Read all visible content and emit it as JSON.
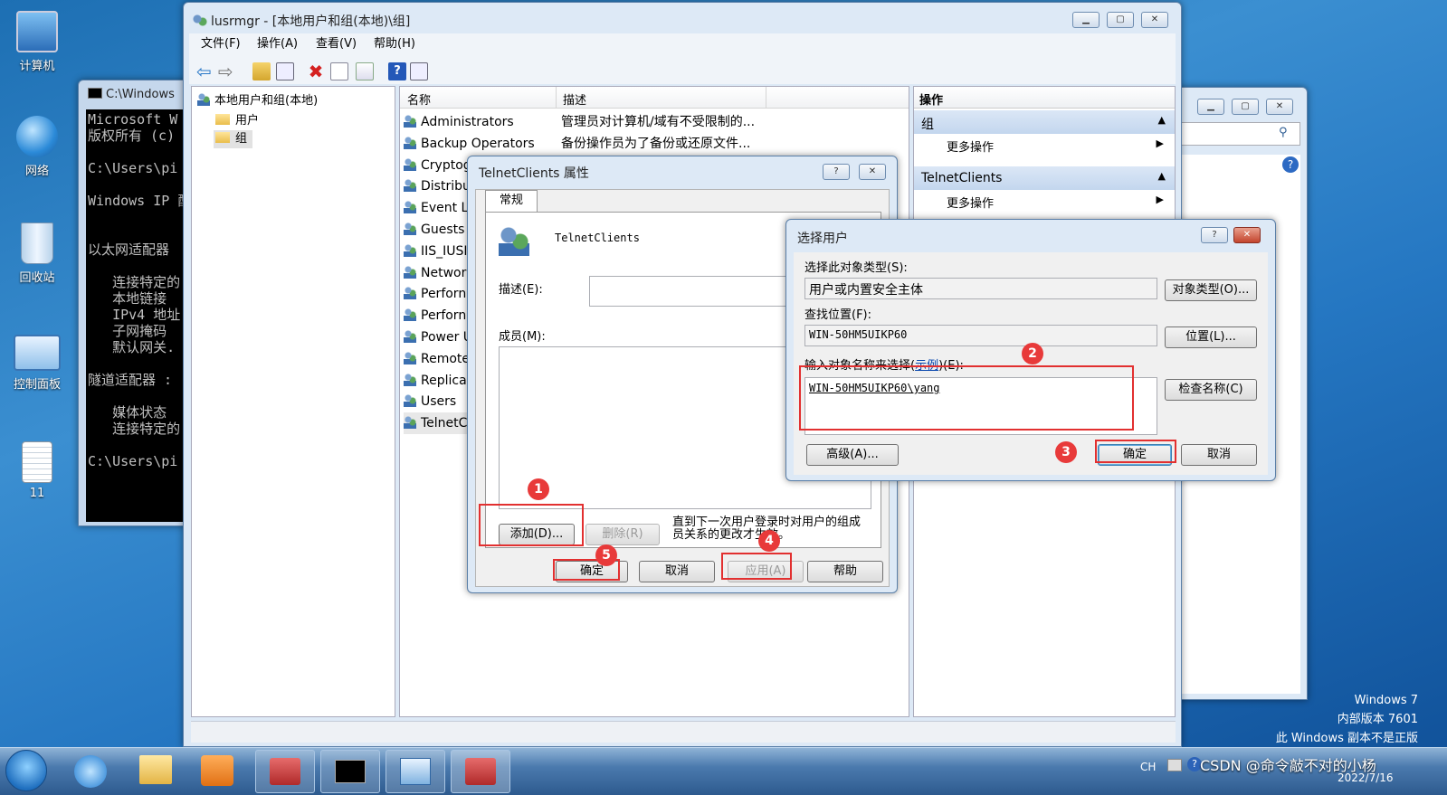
{
  "desktop": {
    "icons": [
      {
        "label": "计算机",
        "icon": "computer-icon"
      },
      {
        "label": "网络",
        "icon": "network-icon"
      },
      {
        "label": "回收站",
        "icon": "recycle-bin-icon"
      },
      {
        "label": "控制面板",
        "icon": "control-panel-icon"
      },
      {
        "label": "11",
        "icon": "text-file-icon"
      }
    ],
    "watermark": {
      "line1": "Windows 7",
      "line2": "内部版本 7601",
      "line3": "此 Windows 副本不是正版"
    },
    "credit": "CSDN @命令敲不对的小杨"
  },
  "cmd": {
    "title": "C:\\Windows",
    "lines": [
      "Microsoft W",
      "版权所有 (c)",
      "",
      "C:\\Users\\pi",
      "",
      "Windows IP 配",
      "",
      "",
      "以太网适配器",
      "",
      "   连接特定的",
      "   本地链接",
      "   IPv4 地址",
      "   子网掩码",
      "   默认网关.",
      "",
      "隧道适配器 :",
      "",
      "   媒体状态",
      "   连接特定的",
      "",
      "C:\\Users\\pi"
    ]
  },
  "mmc": {
    "title": "lusrmgr - [本地用户和组(本地)\\组]",
    "menu": [
      "文件(F)",
      "操作(A)",
      "查看(V)",
      "帮助(H)"
    ],
    "tree": {
      "root": "本地用户和组(本地)",
      "children": [
        "用户",
        "组"
      ]
    },
    "columns": [
      "名称",
      "描述"
    ],
    "groups": [
      {
        "name": "Administrators",
        "desc": "管理员对计算机/域有不受限制的..."
      },
      {
        "name": "Backup Operators",
        "desc": "备份操作员为了备份或还原文件..."
      },
      {
        "name": "Cryptog",
        "desc": ""
      },
      {
        "name": "Distribu",
        "desc": ""
      },
      {
        "name": "Event L",
        "desc": ""
      },
      {
        "name": "Guests",
        "desc": ""
      },
      {
        "name": "IIS_IUSI",
        "desc": ""
      },
      {
        "name": "Networ",
        "desc": ""
      },
      {
        "name": "Perforn",
        "desc": ""
      },
      {
        "name": "Perforn",
        "desc": ""
      },
      {
        "name": "Power U",
        "desc": ""
      },
      {
        "name": "Remote",
        "desc": ""
      },
      {
        "name": "Replica",
        "desc": ""
      },
      {
        "name": "Users",
        "desc": ""
      },
      {
        "name": "TelnetC",
        "desc": ""
      }
    ],
    "actions": {
      "header": "操作",
      "sections": [
        {
          "title": "组",
          "item": "更多操作"
        },
        {
          "title": "TelnetClients",
          "item": "更多操作"
        }
      ]
    }
  },
  "props": {
    "title": "TelnetClients 属性",
    "tab": "常规",
    "group_name": "TelnetClients",
    "desc_label": "描述(E):",
    "members_label": "成员(M):",
    "add_button": "添加(D)...",
    "remove_button": "删除(R)",
    "note": "直到下一次用户登录时对用户的组成员关系的更改才生效。",
    "ok": "确定",
    "cancel": "取消",
    "apply": "应用(A)",
    "help": "帮助"
  },
  "select_user": {
    "title": "选择用户",
    "type_label": "选择此对象类型(S):",
    "type_value": "用户或内置安全主体",
    "type_button": "对象类型(O)...",
    "location_label": "查找位置(F):",
    "location_value": "WIN-50HM5UIKP60",
    "location_button": "位置(L)...",
    "enter_label_pre": "输入对象名称来选择(",
    "enter_label_link": "示例",
    "enter_label_post": ")(E):",
    "entered_value": "WIN-50HM5UIKP60\\yang",
    "check_button": "检查名称(C)",
    "advanced_button": "高级(A)...",
    "ok": "确定",
    "cancel": "取消"
  },
  "annotations": [
    "1",
    "2",
    "3",
    "4",
    "5"
  ],
  "taskbar": {
    "tray": "CH",
    "date": "2022/7/16"
  }
}
